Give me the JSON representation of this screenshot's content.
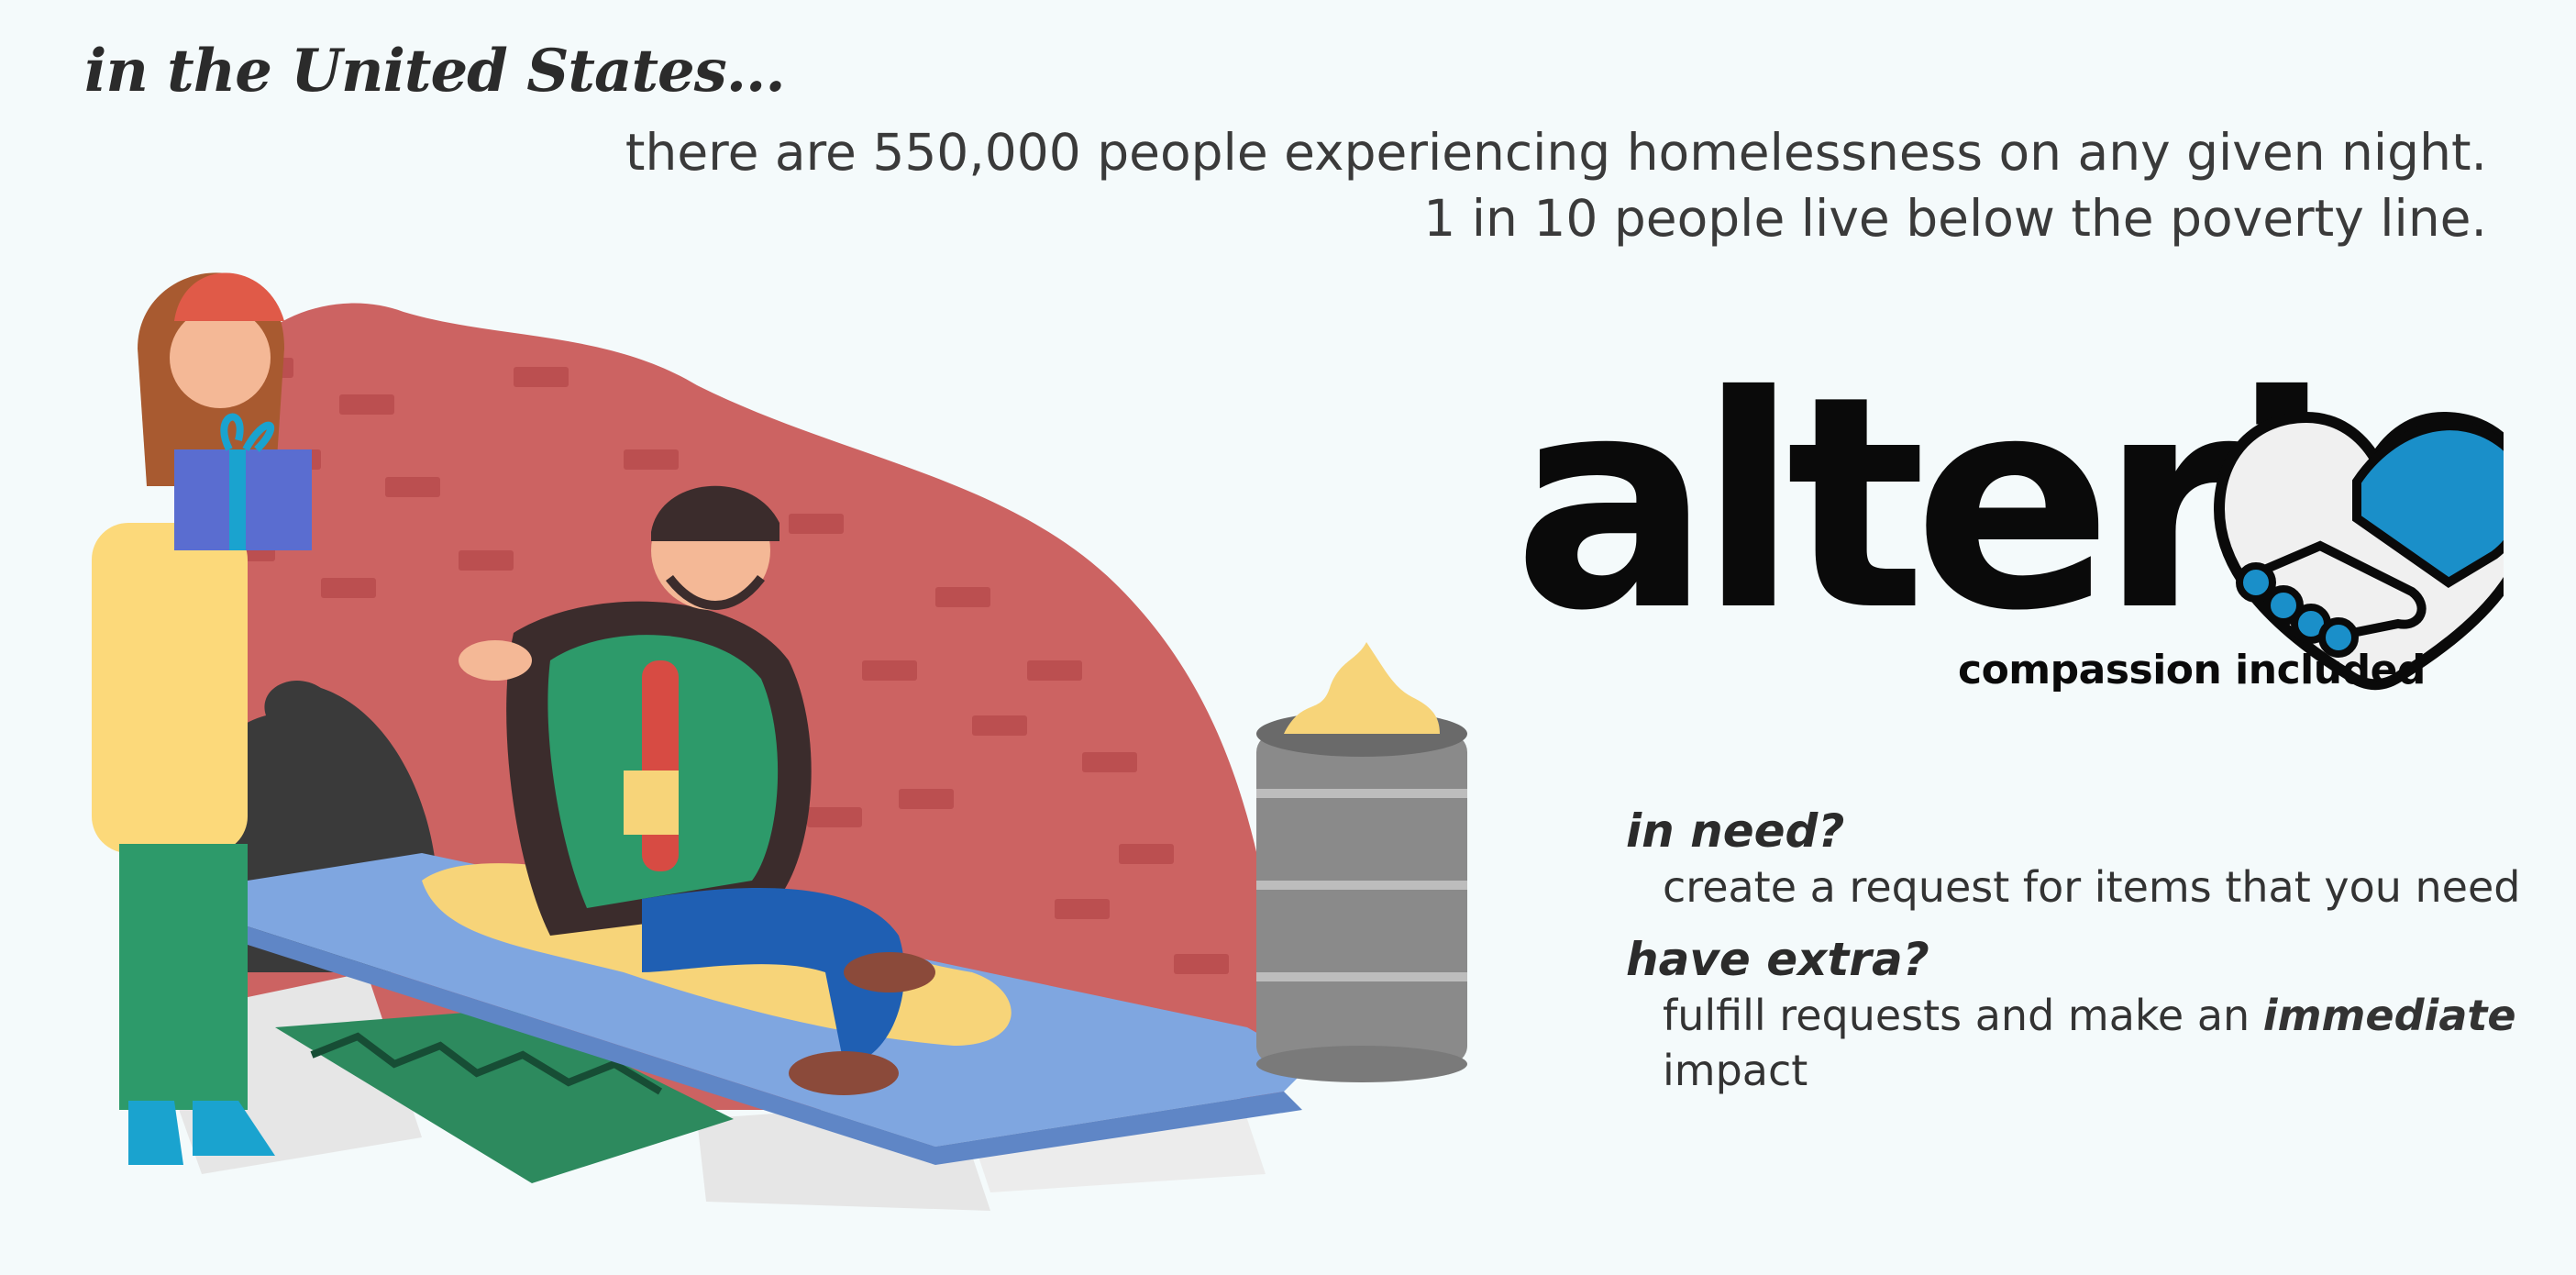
{
  "header": {
    "heading": "in the United States...",
    "stat_1": "there are 550,000 people experiencing homelessness on any given night.",
    "stat_2": "1 in 10 people live below the poverty line."
  },
  "brand": {
    "name": "alteri",
    "tagline": "compassion included",
    "icon": "handshake-heart-icon",
    "accent": "#1a8fc9"
  },
  "info": {
    "need_question": "in need?",
    "need_answer": "create a request for items that you need",
    "extra_question": "have extra?",
    "extra_answer_pre": "fulfill requests and make an",
    "extra_answer_em": "immediate",
    "extra_answer_post": "impact"
  },
  "colors": {
    "background": "#f4fafb",
    "brick_wall": "#cc6362",
    "mattress": "#7fa6e0",
    "jacket_yellow": "#fcd97a",
    "sweater_green": "#2d9a6a"
  }
}
